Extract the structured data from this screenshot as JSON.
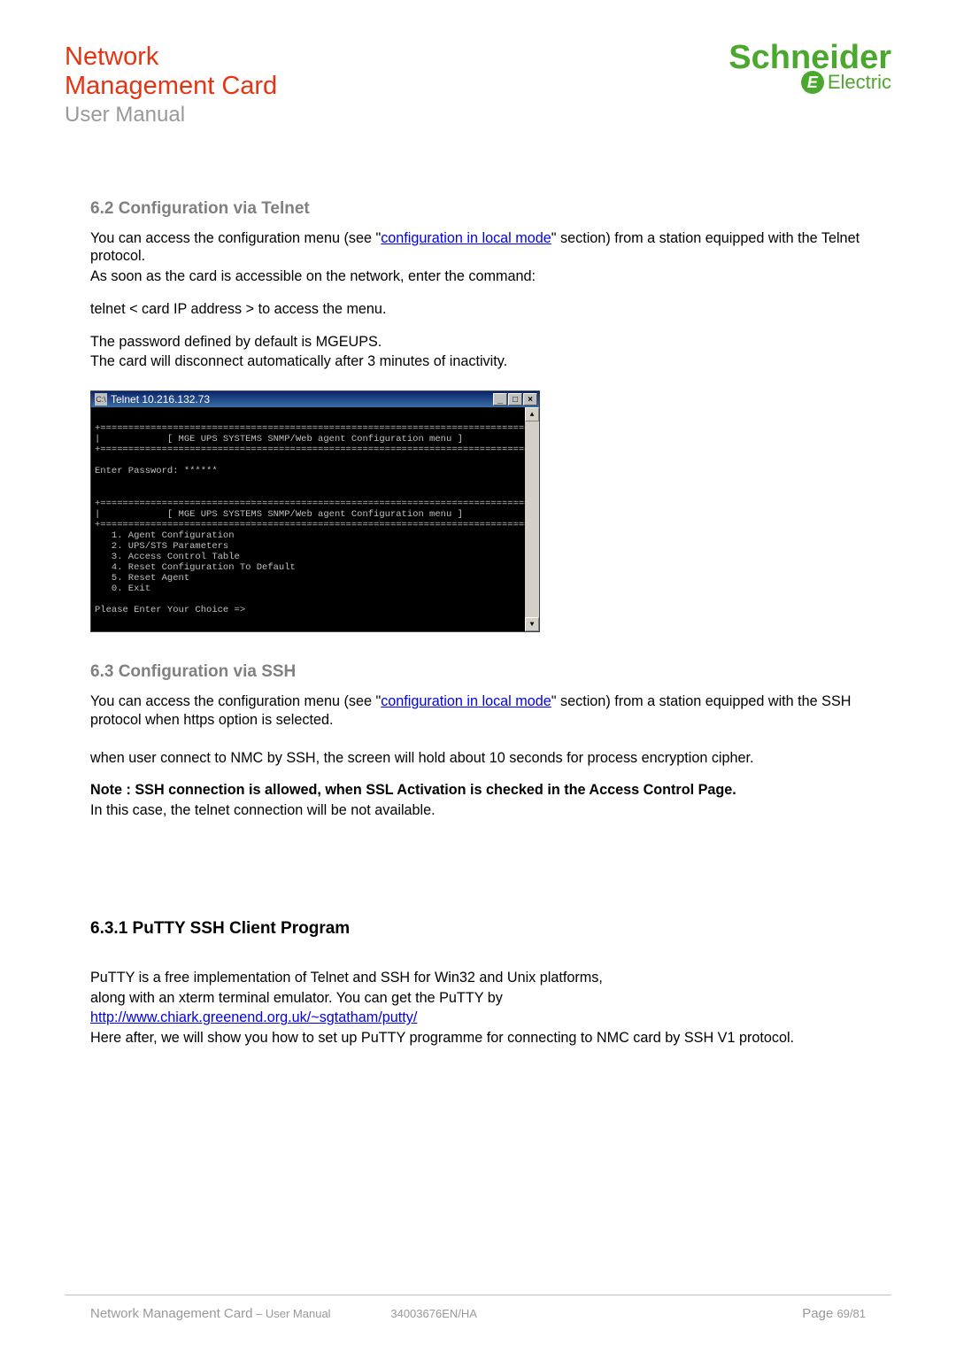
{
  "brand": {
    "title_line1": "Network",
    "title_line2": "Management Card",
    "subtitle": "User Manual",
    "logo_main": "Schneider",
    "logo_sub": "Electric"
  },
  "section62": {
    "heading": "6.2   Configuration via Telnet",
    "para1_a": "You can access the configuration menu (see \"",
    "link1": "configuration in local mode",
    "para1_b": "\" section) from a station equipped with the Telnet protocol.",
    "para2": "As soon as the card is accessible on the network, enter the command:",
    "para3": "telnet < card IP address > to access the menu.",
    "para4": "The password defined by default is MGEUPS.",
    "para5": "The card will disconnect automatically after 3 minutes of inactivity."
  },
  "telnet": {
    "title": "Telnet 10.216.132.73",
    "content": "\n+=============================================================================+\n|            [ MGE UPS SYSTEMS SNMP/Web agent Configuration menu ]            |\n+=============================================================================+\n\nEnter Password: ******\n\n\n+=============================================================================+\n|            [ MGE UPS SYSTEMS SNMP/Web agent Configuration menu ]            |\n+=============================================================================+\n   1. Agent Configuration\n   2. UPS/STS Parameters\n   3. Access Control Table\n   4. Reset Configuration To Default\n   5. Reset Agent\n   0. Exit\n\nPlease Enter Your Choice =>"
  },
  "section63": {
    "heading": "6.3   Configuration via SSH",
    "para1_a": "You can access the configuration menu (see \"",
    "link1": "configuration in local mode",
    "para1_b": "\" section) from a station equipped with the SSH protocol when https option is selected.",
    "para2": "when user connect to NMC by SSH, the screen will hold about 10 seconds for process encryption cipher.",
    "note": "Note : SSH connection is allowed, when SSL Activation is checked in the Access Control Page.",
    "para3": "In this case, the telnet connection will be not available."
  },
  "section631": {
    "heading": "6.3.1  PuTTY SSH Client Program",
    "para1": "PuTTY is a free implementation of Telnet and SSH for Win32 and Unix platforms,",
    "para2": "along with an xterm terminal emulator. You can get the PuTTY by",
    "link": "http://www.chiark.greenend.org.uk/~sgtatham/putty/",
    "para3": "Here after, we will show you how to set up PuTTY programme for connecting to NMC card by SSH V1 protocol."
  },
  "footer": {
    "left_a": "Network Management Card",
    "left_b": " – User Manual",
    "docid": "34003676EN/HA",
    "page_label": "Page ",
    "page_num": "69/81"
  }
}
